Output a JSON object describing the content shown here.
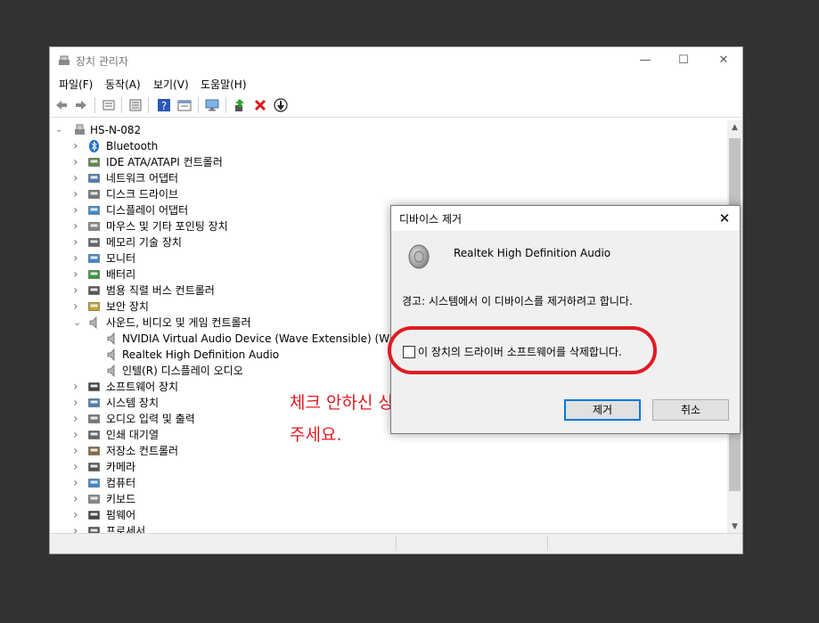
{
  "window": {
    "title": "장치 관리자",
    "controls": {
      "minimize": "—",
      "maximize": "☐",
      "close": "✕"
    }
  },
  "menu": [
    "파일(F)",
    "동작(A)",
    "보기(V)",
    "도움말(H)"
  ],
  "toolbar": {
    "buttons": [
      "back-icon",
      "forward-icon",
      "properties-icon",
      "list-icon",
      "help-icon",
      "view-icon",
      "monitor-icon",
      "update-driver-icon",
      "uninstall-icon",
      "download-icon"
    ]
  },
  "tree": {
    "root": "HS-N-082",
    "items": [
      {
        "label": "Bluetooth",
        "expanded": false,
        "icon": "bluetooth-icon"
      },
      {
        "label": "IDE ATA/ATAPI 컨트롤러",
        "expanded": false,
        "icon": "ide-icon"
      },
      {
        "label": "네트워크 어댑터",
        "expanded": false,
        "icon": "network-icon"
      },
      {
        "label": "디스크 드라이브",
        "expanded": false,
        "icon": "disk-icon"
      },
      {
        "label": "디스플레이 어댑터",
        "expanded": false,
        "icon": "display-icon"
      },
      {
        "label": "마우스 및 기타 포인팅 장치",
        "expanded": false,
        "icon": "mouse-icon"
      },
      {
        "label": "메모리 기술 장치",
        "expanded": false,
        "icon": "memory-icon"
      },
      {
        "label": "모니터",
        "expanded": false,
        "icon": "monitor-icon"
      },
      {
        "label": "배터리",
        "expanded": false,
        "icon": "battery-icon"
      },
      {
        "label": "범용 직렬 버스 컨트롤러",
        "expanded": false,
        "icon": "usb-icon"
      },
      {
        "label": "보안 장치",
        "expanded": false,
        "icon": "security-icon"
      },
      {
        "label": "사운드, 비디오 및 게임 컨트롤러",
        "expanded": true,
        "icon": "speaker-icon"
      },
      {
        "label": "NVIDIA Virtual Audio Device (Wave Extensible) (WDM)",
        "child": true,
        "icon": "speaker-icon"
      },
      {
        "label": "Realtek High Definition Audio",
        "child": true,
        "icon": "speaker-icon"
      },
      {
        "label": "인텔(R) 디스플레이 오디오",
        "child": true,
        "icon": "speaker-icon"
      },
      {
        "label": "소프트웨어 장치",
        "expanded": false,
        "icon": "software-icon"
      },
      {
        "label": "시스템 장치",
        "expanded": false,
        "icon": "system-icon"
      },
      {
        "label": "오디오 입력 및 출력",
        "expanded": false,
        "icon": "audio-io-icon"
      },
      {
        "label": "인쇄 대기열",
        "expanded": false,
        "icon": "printer-icon"
      },
      {
        "label": "저장소 컨트롤러",
        "expanded": false,
        "icon": "storage-icon"
      },
      {
        "label": "카메라",
        "expanded": false,
        "icon": "camera-icon"
      },
      {
        "label": "컴퓨터",
        "expanded": false,
        "icon": "computer-icon"
      },
      {
        "label": "키보드",
        "expanded": false,
        "icon": "keyboard-icon"
      },
      {
        "label": "펌웨어",
        "expanded": false,
        "icon": "firmware-icon"
      },
      {
        "label": "프로세서",
        "expanded": false,
        "icon": "processor-icon"
      }
    ]
  },
  "dialog": {
    "title": "디바이스 제거",
    "device_name": "Realtek High Definition Audio",
    "warning": "경고: 시스템에서 이 디바이스를 제거하려고 합니다.",
    "checkbox_label": "이 장치의 드라이버 소프트웨어를 삭제합니다.",
    "checkbox_checked": false,
    "ok_button": "제거",
    "cancel_button": "취소",
    "close": "✕"
  },
  "annotation": {
    "line1": "체크 안하신 상태로 제거 눌러",
    "line2": "주세요.",
    "color": "#e01b22"
  }
}
